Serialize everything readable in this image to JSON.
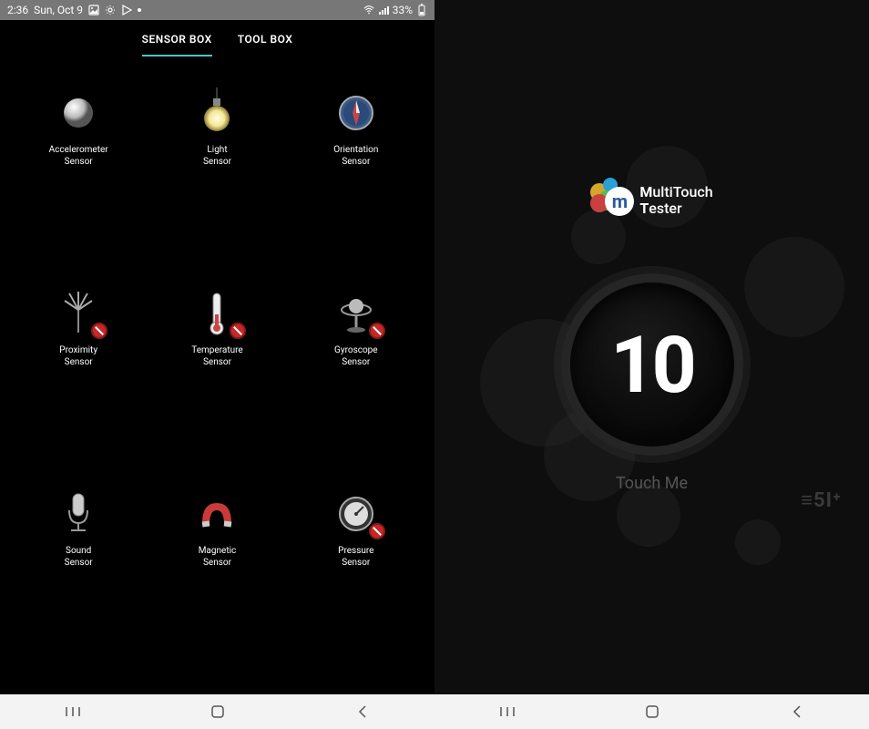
{
  "status": {
    "time": "2:36",
    "date": "Sun, Oct 9",
    "battery": "33%"
  },
  "tabs": {
    "sensor_box": "SENSOR BOX",
    "tool_box": "TOOL BOX"
  },
  "sensors": [
    {
      "label": "Accelerometer\nSensor",
      "disabled": false,
      "icon": "ball"
    },
    {
      "label": "Light\nSensor",
      "disabled": false,
      "icon": "bulb"
    },
    {
      "label": "Orientation\nSensor",
      "disabled": false,
      "icon": "compass"
    },
    {
      "label": "Proximity\nSensor",
      "disabled": true,
      "icon": "flower"
    },
    {
      "label": "Temperature\nSensor",
      "disabled": true,
      "icon": "thermometer"
    },
    {
      "label": "Gyroscope\nSensor",
      "disabled": true,
      "icon": "gyro"
    },
    {
      "label": "Sound\nSensor",
      "disabled": false,
      "icon": "mic"
    },
    {
      "label": "Magnetic\nSensor",
      "disabled": false,
      "icon": "magnet"
    },
    {
      "label": "Pressure\nSensor",
      "disabled": true,
      "icon": "gauge"
    }
  ],
  "multitouch": {
    "app_name_line1": "ultiTouch",
    "app_name_line2": "ester",
    "big_number": "10",
    "touch_label": "Touch Me",
    "brand": "≡5I⁺"
  }
}
